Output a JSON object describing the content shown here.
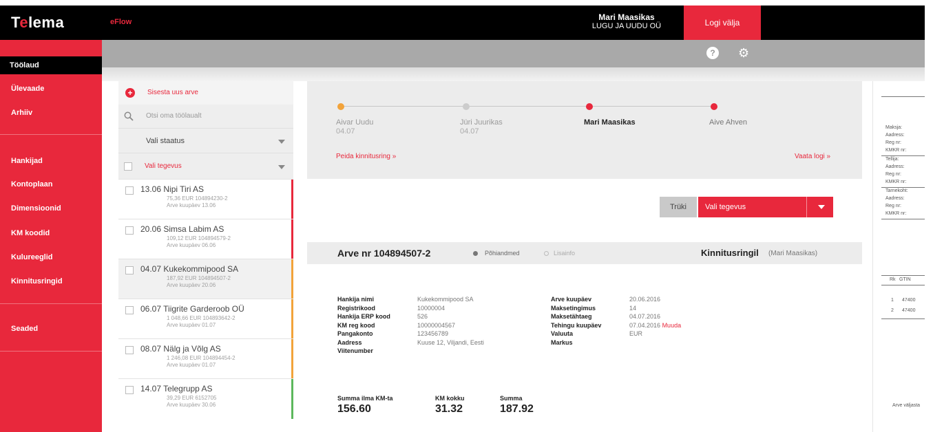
{
  "header": {
    "logo_pre": "T",
    "logo_e": "e",
    "logo_post": "lema",
    "product": "eFlow",
    "user_name": "Mari Maasikas",
    "company": "LUGU JA UUDU OÜ",
    "logout_label": "Logi välja"
  },
  "toolbar": {
    "help_glyph": "?",
    "settings_glyph": "⚙"
  },
  "nav": {
    "active": "Töölaud",
    "items": [
      "Ülevaade",
      "Arhiiv",
      "Hankijad",
      "Kontoplaan",
      "Dimensioonid",
      "KM koodid",
      "Kulureeglid",
      "Kinnitusringid",
      "Seaded"
    ]
  },
  "list": {
    "add_label": "Sisesta uus arve",
    "search_placeholder": "Otsi oma töölaualt",
    "status_label": "Vali staatus",
    "action_label": "Vali tegevus",
    "items": [
      {
        "title": "13.06 Nipi Tiri AS",
        "line1": "75,36 EUR 104894230-2",
        "line2": "Arve kuupäev 13.06",
        "color": "#e8283c"
      },
      {
        "title": "20.06 Simsa Labim AS",
        "line1": "109,12 EUR 104894579-2",
        "line2": "Arve kuupäev 06.06",
        "color": "#e8283c"
      },
      {
        "title": "04.07 Kukekommipood SA",
        "line1": "187,92 EUR 104894507-2",
        "line2": "Arve kuupäev 20.06",
        "color": "#f2a33a"
      },
      {
        "title": "06.07 Tiigrite Garderoob OÜ",
        "line1": "1 048,66 EUR 104893642-2",
        "line2": "Arve kuupäev 01.07",
        "color": "#f2a33a"
      },
      {
        "title": "08.07 Nälg ja Võlg AS",
        "line1": "1 246,08 EUR 104894454-2",
        "line2": "Arve kuupäev 01.07",
        "color": "#f2a33a"
      },
      {
        "title": "14.07 Telegrupp AS",
        "line1": "39,29 EUR 6152705",
        "line2": "Arve kuupäev 30.06",
        "color": "#5cb85c"
      }
    ]
  },
  "workflow": {
    "steps": [
      {
        "name": "Aivar Uudu",
        "date": "04.07",
        "color": "#f2a33a"
      },
      {
        "name": "Jüri Juurikas",
        "date": "04.07",
        "color": "#cccccc"
      },
      {
        "name": "Mari Maasikas",
        "date": "",
        "color": "#e8283c"
      },
      {
        "name": "Aive Ahven",
        "date": "",
        "color": "#e8283c"
      }
    ],
    "hide_link": "Peida kinnitusring »",
    "log_link": "Vaata logi »"
  },
  "invoice": {
    "print_label": "Trüki",
    "action_label": "Vali tegevus",
    "number_label": "Arve nr 104894507-2",
    "tab_main": "Põhiandmed",
    "tab_extra": "Lisainfo",
    "approval_title": "Kinnitusringil",
    "approval_person": "(Mari Maasikas)",
    "left_labels": [
      "Hankija nimi",
      "Registrikood",
      "Hankija ERP kood",
      "KM reg kood",
      "Pangakonto",
      "Aadress",
      "Viitenumber"
    ],
    "left_values": [
      "Kukekommipood SA",
      "10000004",
      "526",
      "10000004567",
      "123456789",
      "Kuuse 12, Viljandi, Eesti",
      ""
    ],
    "right_labels": [
      "Arve kuupäev",
      "Maksetingimus",
      "Maksetähtaeg",
      "Tehingu kuupäev",
      "Valuuta",
      "Markus"
    ],
    "right_values": [
      "20.06.2016",
      "14",
      "04.07.2016",
      "07.04.2016",
      "EUR",
      ""
    ],
    "change_link": "Muuda",
    "sum_no_vat_label": "Summa ilma KM-ta",
    "sum_no_vat": "156.60",
    "vat_label": "KM kokku",
    "vat": "31.32",
    "total_label": "Summa",
    "total": "187.92"
  },
  "preview": {
    "lines": [
      "Maksja:",
      "Aadress:",
      "Reg nr:",
      "KMKR nr:",
      "Tellija:",
      "Aadress:",
      "Reg nr:",
      "KMKR nr:",
      "Tarnekoht:",
      "Aadress:",
      "Reg nr:",
      "KMKR nr:"
    ],
    "col1": "Rk",
    "col2": "GTIN",
    "row1_no": "1",
    "row1_val": "47400",
    "row2_no": "2",
    "row2_val": "47400",
    "footer": "Arve väljasta"
  }
}
